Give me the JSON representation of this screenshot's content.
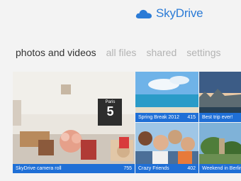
{
  "brand": {
    "name": "SkyDrive",
    "icon": "cloud-icon",
    "color": "#2b7bd6"
  },
  "tabs": [
    {
      "label": "photos and videos",
      "active": true
    },
    {
      "label": "all files",
      "active": false
    },
    {
      "label": "shared",
      "active": false
    },
    {
      "label": "settings",
      "active": false
    }
  ],
  "tiles": {
    "camera_roll": {
      "title": "SkyDrive camera roll",
      "count": "755"
    },
    "spring_break": {
      "title": "Spring Break 2012",
      "count": "415"
    },
    "best_trip": {
      "title": "Best trip ever!"
    },
    "crazy_friends": {
      "title": "Crazy Friends",
      "count": "402"
    },
    "weekend_berlin": {
      "title": "Weekend in Berlin"
    }
  },
  "clock_prop": {
    "city": "Paris",
    "digit": "5"
  },
  "accent_color": "#1f6fd6"
}
